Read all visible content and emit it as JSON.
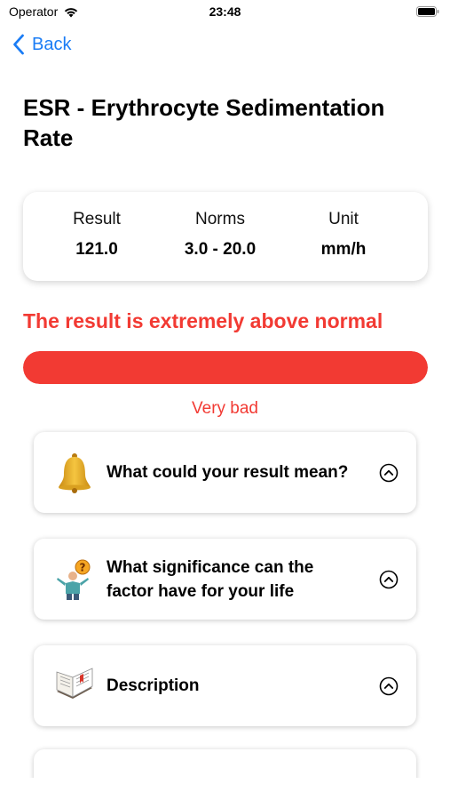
{
  "status_bar": {
    "carrier": "Operator",
    "time": "23:48"
  },
  "nav": {
    "back_label": "Back"
  },
  "page": {
    "title": "ESR - Erythrocyte Sedimentation Rate"
  },
  "summary": {
    "result_label": "Result",
    "result_value": "121.0",
    "norms_label": "Norms",
    "norms_value": "3.0 - 20.0",
    "unit_label": "Unit",
    "unit_value": "mm/h"
  },
  "assessment": {
    "verdict": "The result is extremely above normal",
    "rating": "Very bad",
    "severity_fraction": 1.0,
    "severity_color": "#f23a33"
  },
  "sections": [
    {
      "title": "What could your result mean?",
      "icon": "bell-icon"
    },
    {
      "title": "What significance can the factor have for your life",
      "icon": "question-person-icon"
    },
    {
      "title": "Description",
      "icon": "book-icon"
    },
    {
      "title": "",
      "icon": "partial-red-icon"
    }
  ],
  "colors": {
    "accent_blue": "#1a7cf5",
    "alert_red": "#f23a33"
  }
}
